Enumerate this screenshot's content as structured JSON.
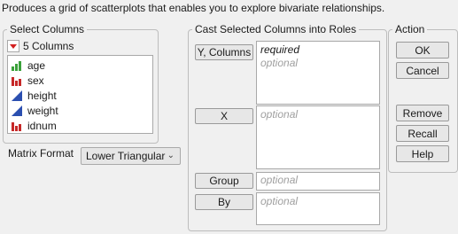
{
  "description": "Produces a grid of scatterplots that enables you to explore bivariate relationships.",
  "select_columns": {
    "title": "Select Columns",
    "count_label": "5 Columns",
    "columns": [
      {
        "label": "age",
        "icon": "ordinal-icon",
        "color": "#3aa13a"
      },
      {
        "label": "sex",
        "icon": "nominal-icon",
        "color": "#c62828"
      },
      {
        "label": "height",
        "icon": "continuous-icon",
        "color": "#2b4fb0"
      },
      {
        "label": "weight",
        "icon": "continuous-icon",
        "color": "#2b4fb0"
      },
      {
        "label": "idnum",
        "icon": "nominal-icon",
        "color": "#c62828"
      }
    ]
  },
  "matrix_format": {
    "label": "Matrix Format",
    "value": "Lower Triangular"
  },
  "cast": {
    "title": "Cast Selected Columns into Roles",
    "roles": [
      {
        "button": "Y, Columns",
        "lines": [
          "required",
          "optional"
        ]
      },
      {
        "button": "X",
        "lines": [
          "optional"
        ]
      },
      {
        "button": "Group",
        "lines": [
          "optional"
        ]
      },
      {
        "button": "By",
        "lines": [
          "optional"
        ]
      }
    ]
  },
  "action": {
    "title": "Action",
    "buttons": [
      "OK",
      "Cancel",
      "Remove",
      "Recall",
      "Help"
    ]
  }
}
